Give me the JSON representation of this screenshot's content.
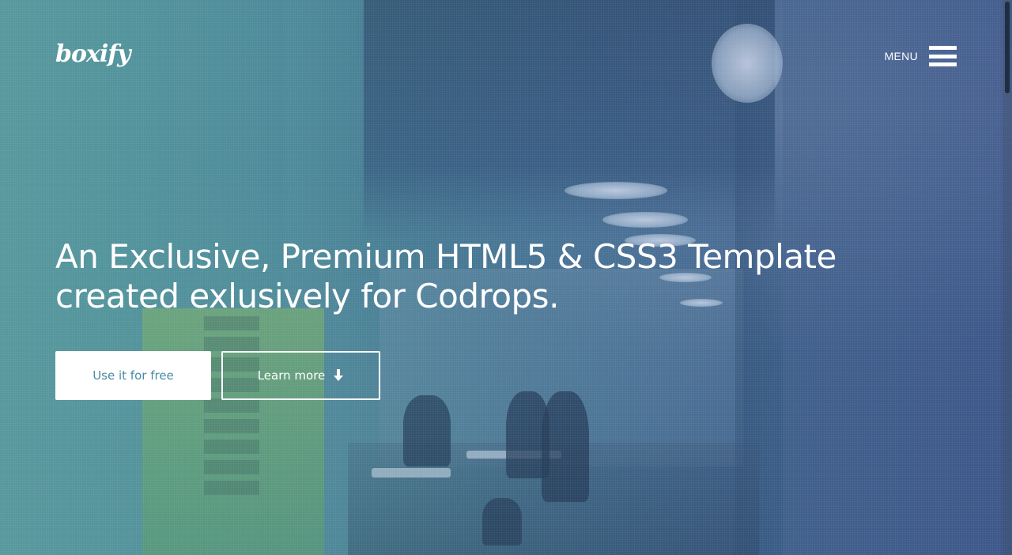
{
  "header": {
    "logo": "boxify",
    "menu_label": "MENU"
  },
  "hero": {
    "headline": "An Exclusive, Premium HTML5 & CSS3 Template created exlusively for Codrops.",
    "primary_button": "Use it for free",
    "secondary_button": "Learn more",
    "secondary_button_icon": "arrow-down-icon"
  },
  "colors": {
    "primary_button_text": "#4a8aa5",
    "overlay": "#3f6f8c",
    "text": "#ffffff"
  }
}
